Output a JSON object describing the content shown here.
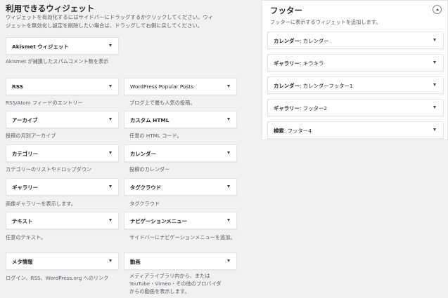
{
  "available": {
    "title": "利用できるウィジェット",
    "desc_lines": [
      "ウィジェットを有効化するにはサイドバーにドラッグするかクリックしてください。ウィ",
      "ジェットを無効化し設定を削除したい場合は、ドラッグして右側に戻してください。"
    ],
    "widgets": [
      {
        "title": "Akismet ウィジェット",
        "desc": [
          "Akismet が捕獲したスパムコメント数を表示"
        ]
      },
      {
        "title": "RSS",
        "desc": [
          "RSS/Atom フィードのエントリー"
        ]
      },
      {
        "title": "WordPress Popular Posts",
        "desc": [
          "ブログ上で最も人気の投稿。"
        ]
      },
      {
        "title": "アーカイブ",
        "desc": [
          "投稿の月別アーカイブ"
        ]
      },
      {
        "title": "カスタム HTML",
        "desc": [
          "任意の HTML コード。"
        ]
      },
      {
        "title": "カテゴリー",
        "desc": [
          "カテゴリーのリストやドロップダウン"
        ]
      },
      {
        "title": "カレンダー",
        "desc": [
          "投稿のカレンダー"
        ]
      },
      {
        "title": "ギャラリー",
        "desc": [
          "画像ギャラリーを表示します。"
        ]
      },
      {
        "title": "タグクラウド",
        "desc": [
          "タグクラウド"
        ]
      },
      {
        "title": "テキスト",
        "desc": [
          "任意のテキスト。"
        ]
      },
      {
        "title": "ナビゲーションメニュー",
        "desc": [
          "サイドバーにナビゲーションメニューを追加。"
        ]
      },
      {
        "title": "メタ情報",
        "desc": [
          "ログイン、RSS、WordPress.org へのリンク"
        ]
      },
      {
        "title": "動画",
        "desc": [
          "メディアライブラリ内から、または",
          "YouTube・Vimeo・その他のプロバイダ",
          "からの動画を表示します。"
        ]
      }
    ]
  },
  "footer": {
    "title": "フッター",
    "desc": "フッターに表示するウィジェットを追加します。",
    "widgets": [
      {
        "title": "カレンダー",
        "sub": ": カレンダー"
      },
      {
        "title": "ギャラリー",
        "sub": ": キラキラ"
      },
      {
        "title": "カレンダー",
        "sub": ": カレンダーフッター1"
      },
      {
        "title": "ギャラリー",
        "sub": ": フッター2"
      },
      {
        "title": "検索",
        "sub": ": フッター4"
      }
    ]
  },
  "colors": {
    "background": "#f1f1f1",
    "panel": "#ffffff",
    "border": "#e2e4e7",
    "text": "#23282d",
    "muted": "#555d66"
  },
  "icons": {
    "widget_toggle": "arrow-down-icon",
    "panel_toggle": "arrow-up-circle-icon"
  }
}
